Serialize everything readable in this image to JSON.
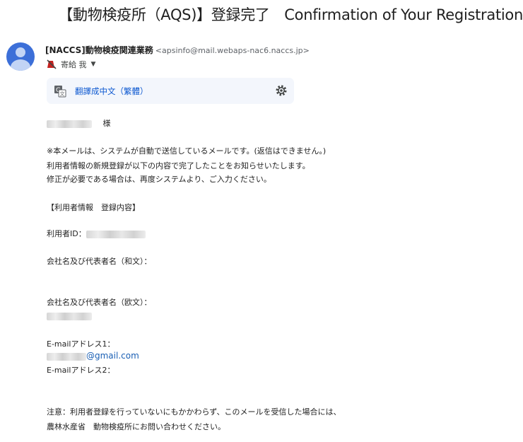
{
  "subject": "【動物検疫所（AQS)】登録完了　Confirmation of Your Registration",
  "sender": {
    "name": "[NACCS]動物検疫関連業務",
    "email": "<apsinfo@mail.webaps-nac6.naccs.jp>"
  },
  "recipient": {
    "label": "寄給 我"
  },
  "translate": {
    "label": "翻譯成中文（繁體）"
  },
  "body": {
    "greeting_suffix": "様",
    "intro": [
      "※本メールは、システムが自動で送信しているメールです。(返信はできません。)",
      "利用者情報の新規登録が以下の内容で完了したことをお知らせいたします。",
      "修正が必要である場合は、再度システムより、ご入力ください。"
    ],
    "section_title": "【利用者情報　登録内容】",
    "user_id_label": "利用者ID：",
    "company_jp_label": "会社名及び代表者名（和文）：",
    "company_en_label": "会社名及び代表者名（欧文）：",
    "email1_label": "E-mailアドレス1：",
    "email1_domain": "@gmail.com",
    "email2_label": "E-mailアドレス2：",
    "notice": [
      "注意：利用者登録を行っていないにもかかわらず、このメールを受信した場合には、",
      "農林水産省　動物検疫所にお問い合わせください。"
    ]
  },
  "colors": {
    "link": "#1a5fb4",
    "avatar": "#3c6fd8",
    "translate_bg": "#f3f6fc"
  }
}
